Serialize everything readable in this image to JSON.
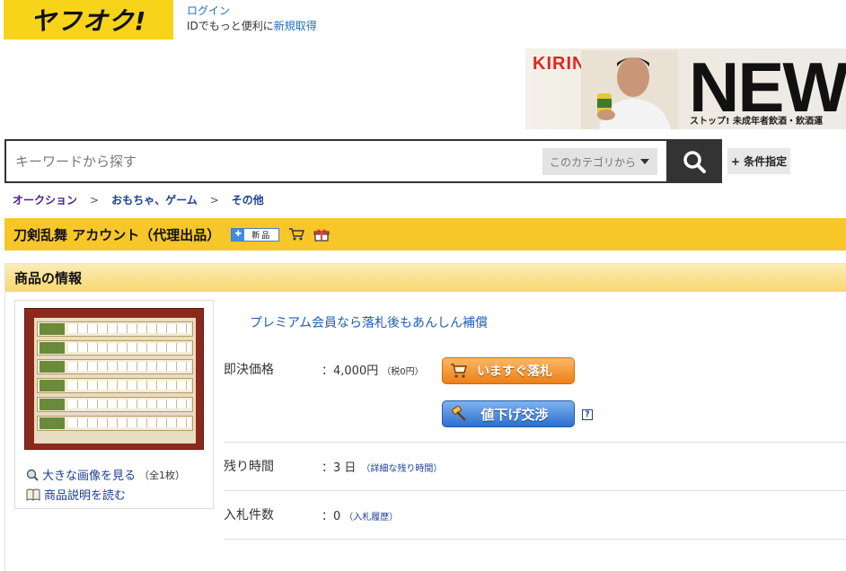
{
  "header": {
    "logo_text": "ヤフオク!",
    "login_label": "ログイン",
    "login_sub_prefix": "IDでもっと便利に",
    "register_label": "新規取得"
  },
  "ad": {
    "brand": "KIRIN",
    "headline": "NEW",
    "note": "ストップ! 未成年者飲酒・飲酒運"
  },
  "search": {
    "placeholder": "キーワードから探す",
    "category_label": "このカテゴリから",
    "search_icon": "search-icon",
    "conditions_label": "+ 条件指定"
  },
  "breadcrumb": {
    "items": [
      "オークション",
      "おもちゃ、ゲーム",
      "その他"
    ],
    "separator": ">"
  },
  "item": {
    "title": "刀剣乱舞 アカウント（代理出品）",
    "new_badge": "新品",
    "cart_icon": "cart-icon",
    "gift_icon": "gift-icon"
  },
  "info": {
    "section_title": "商品の情報",
    "enlarge_label": "大きな画像を見る",
    "enlarge_count": "（全1枚）",
    "description_label": "商品説明を読む",
    "premium_text": "プレミアム会員なら落札後もあんしん補償",
    "buyout_label": "即決価格",
    "buyout_value": "：4,000円",
    "buyout_tax": "（税0円）",
    "buy_now_button": "いますぐ落札",
    "negotiate_button": "値下げ交渉",
    "help_icon": "?",
    "remaining_label": "残り時間",
    "remaining_value": "：3 日",
    "remaining_link": "（詳細な残り時間）",
    "bids_label": "入札件数",
    "bids_value": "：0",
    "bids_link": "（入札履歴）"
  },
  "colors": {
    "brand_yellow": "#f7d31a",
    "title_bar": "#f7c629",
    "link_blue": "#1c3f94",
    "buy_orange": "#ee7f17",
    "negotiate_blue": "#2b6fce"
  }
}
